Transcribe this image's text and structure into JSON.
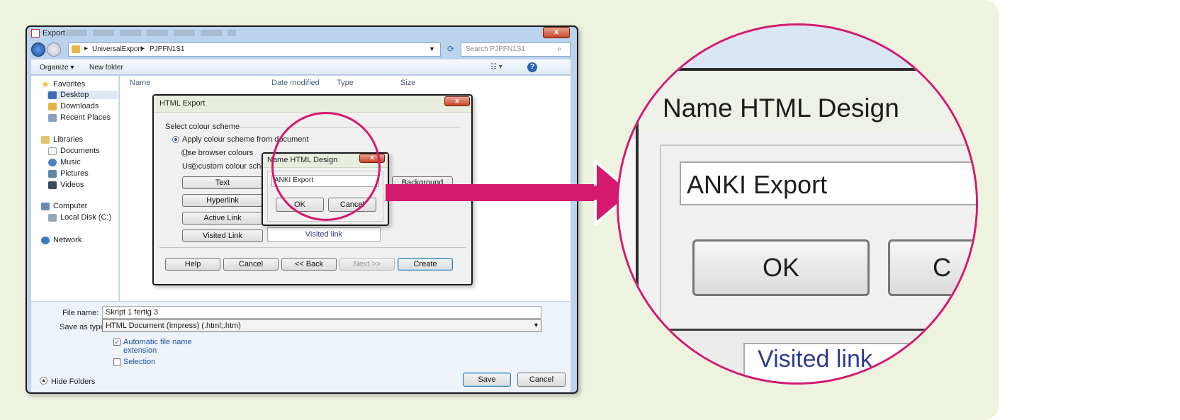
{
  "export_window": {
    "title": "Export",
    "close": "x",
    "breadcrumb": [
      "UniversalExport",
      "PJPFN1S1"
    ],
    "search_placeholder": "Search PJPFN1S1",
    "toolbar": {
      "organize": "Organize",
      "new_folder": "New folder"
    },
    "nav": {
      "favorites": "Favorites",
      "desktop": "Desktop",
      "downloads": "Downloads",
      "recent_places": "Recent Places",
      "libraries": "Libraries",
      "documents": "Documents",
      "music": "Music",
      "pictures": "Pictures",
      "videos": "Videos",
      "computer": "Computer",
      "local_disk": "Local Disk (C:)",
      "network": "Network"
    },
    "columns": [
      "Name",
      "Date modified",
      "Type",
      "Size"
    ],
    "file_name_label": "File name:",
    "file_name_value": "Skript 1 fertig 3",
    "save_as_label": "Save as type:",
    "save_as_value": "HTML Document (Impress) (.html;.htm)",
    "auto_ext_line1": "Automatic file name",
    "auto_ext_line2": "extension",
    "selection": "Selection",
    "hide_folders": "Hide Folders",
    "save": "Save",
    "cancel": "Cancel"
  },
  "html_export": {
    "title": "HTML Export",
    "close": "x",
    "group": "Select colour scheme",
    "opt_document": "Apply colour scheme from document",
    "opt_browser": "Use browser colours",
    "opt_custom": "Use custom colour scheme",
    "btn_text": "Text",
    "btn_hyperlink": "Hyperlink",
    "btn_active": "Active Link",
    "btn_visited": "Visited Link",
    "btn_background": "Background",
    "visited_preview": "Visited link",
    "help": "Help",
    "cancel": "Cancel",
    "back": "<< Back",
    "next": "Next >>",
    "create": "Create"
  },
  "name_dialog": {
    "title": "Name HTML Design",
    "close": "x",
    "input_value": "ANKI Export",
    "ok": "OK",
    "cancel": "Cancel"
  },
  "zoom": {
    "title": "Name HTML Design",
    "input_value": "ANKI Export",
    "ok": "OK",
    "cancel_partial": "C",
    "visited_partial": "Visited link"
  },
  "colors": {
    "accent": "#d4196f",
    "window_frame": "#bcd3ee",
    "background": "#eef3e0"
  }
}
